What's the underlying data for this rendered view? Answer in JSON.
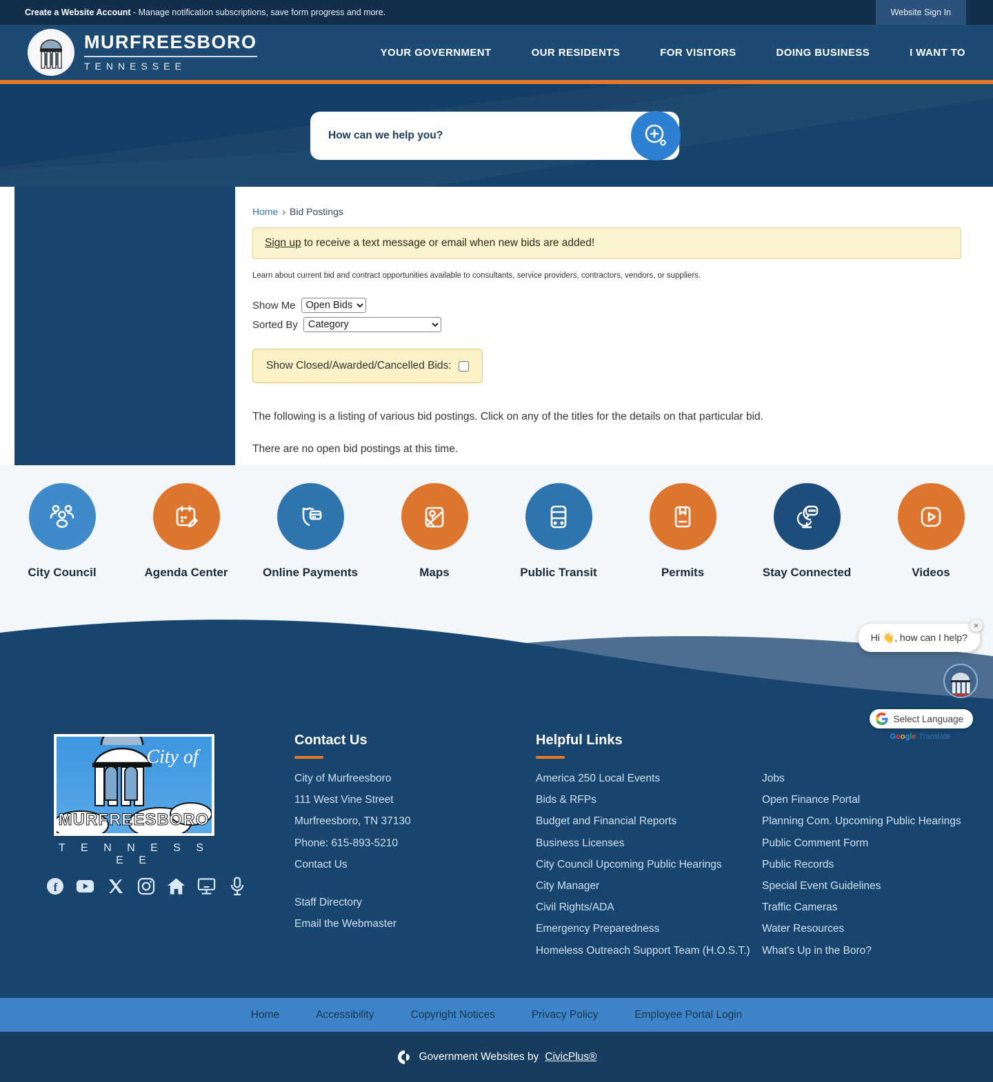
{
  "topbar": {
    "account_bold": "Create a Website Account",
    "account_rest": " - Manage notification subscriptions, save form progress and more.",
    "signin": "Website Sign In"
  },
  "header": {
    "logo_title": "MURFREESBORO",
    "logo_subtitle": "TENNESSEE",
    "nav": [
      "YOUR GOVERNMENT",
      "OUR RESIDENTS",
      "FOR VISITORS",
      "DOING BUSINESS",
      "I WANT TO"
    ]
  },
  "search": {
    "placeholder": "How can we help you?",
    "icon": "search-plus-icon"
  },
  "breadcrumb": {
    "home": "Home",
    "sep": "›",
    "current": "Bid Postings"
  },
  "notice": {
    "link": "Sign up",
    "rest": " to receive a text message or email when new bids are added!"
  },
  "intro": "Learn about current bid and contract opportunities available to consultants, service providers, contractors, vendors, or suppliers.",
  "filters": {
    "show_me_label": "Show Me",
    "show_me_value": "Open Bids",
    "sorted_by_label": "Sorted By",
    "sorted_by_value": "Category",
    "closed_label": "Show Closed/Awarded/Cancelled Bids:"
  },
  "listing": {
    "description": "The following is a listing of various bid postings. Click on any of the titles for the details on that particular bid.",
    "empty": "There are no open bid postings at this time."
  },
  "quicklinks": [
    {
      "label": "City Council",
      "color": "#3f8bc9",
      "icon": "people-icon"
    },
    {
      "label": "Agenda Center",
      "color": "#de752f",
      "icon": "calendar-pencil-icon"
    },
    {
      "label": "Online Payments",
      "color": "#2e74ae",
      "icon": "payment-shield-icon"
    },
    {
      "label": "Maps",
      "color": "#de752f",
      "icon": "map-pin-icon"
    },
    {
      "label": "Public Transit",
      "color": "#2e74ae",
      "icon": "bus-icon"
    },
    {
      "label": "Permits",
      "color": "#de752f",
      "icon": "permit-book-icon"
    },
    {
      "label": "Stay Connected",
      "color": "#1d4d7b",
      "icon": "chat-monitor-icon"
    },
    {
      "label": "Videos",
      "color": "#de752f",
      "icon": "video-play-icon"
    }
  ],
  "chat": {
    "greeting": "Hi 👋, how can I help?",
    "close": "×"
  },
  "translate": {
    "label": "Select Language",
    "attr_google": "Google",
    "attr_translate": "Translate"
  },
  "footer": {
    "logo": {
      "city_of": "City of",
      "name": "MURFREESBORO",
      "state": "T E N N E S S E E"
    },
    "social_icons": [
      "facebook-icon",
      "youtube-icon",
      "x-icon",
      "instagram-icon",
      "nextdoor-icon",
      "monitor-icon",
      "microphone-icon"
    ],
    "contact": {
      "heading": "Contact Us",
      "lines": [
        "City of Murfreesboro",
        "111 West Vine Street",
        "Murfreesboro, TN 37130",
        "Phone: 615-893-5210",
        "Contact Us"
      ],
      "links2": [
        "Staff Directory",
        "Email the Webmaster"
      ]
    },
    "helpful": {
      "heading": "Helpful Links",
      "col1": [
        "America 250 Local Events",
        "Bids & RFPs",
        "Budget and Financial Reports",
        "Business Licenses",
        "City Council Upcoming Public Hearings",
        "City Manager",
        "Civil Rights/ADA",
        "Emergency Preparedness",
        "Homeless Outreach Support Team (H.O.S.T.)"
      ],
      "col2": [
        "Jobs",
        "Open Finance Portal",
        "Planning Com. Upcoming Public Hearings",
        "Public Comment Form",
        "Public Records",
        "Special Event Guidelines",
        "Traffic Cameras",
        "Water Resources",
        "What's Up in the Boro?"
      ]
    }
  },
  "bottombar": {
    "links": [
      "Home",
      "Accessibility",
      "Copyright Notices",
      "Privacy Policy",
      "Employee Portal Login"
    ]
  },
  "civicplus": {
    "prefix": "Government Websites by",
    "link": "CivicPlus®"
  },
  "colors": {
    "accent_orange": "#e8782a",
    "navy": "#17456e",
    "header_blue": "#1d4a72",
    "bottom_blue": "#3d85c8",
    "notice_yellow": "#fbf3cd"
  }
}
